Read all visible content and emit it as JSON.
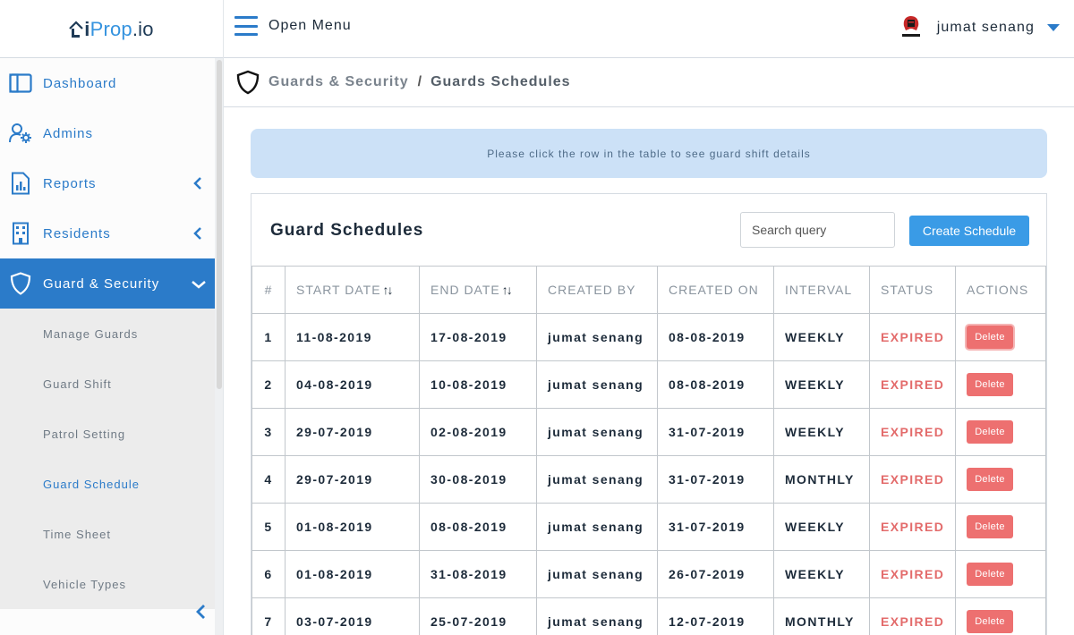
{
  "brand": {
    "part1": "i",
    "part2": "Prop",
    "part3": ".io"
  },
  "header": {
    "menu_label": "Open Menu",
    "user_name": "jumat senang"
  },
  "sidebar": {
    "items": [
      {
        "label": "Dashboard",
        "icon": "columns-icon"
      },
      {
        "label": "Admins",
        "icon": "user-gear-icon"
      },
      {
        "label": "Reports",
        "icon": "report-icon"
      },
      {
        "label": "Residents",
        "icon": "building-icon"
      },
      {
        "label": "Guard & Security",
        "icon": "shield-icon"
      }
    ],
    "sub_items": [
      "Manage Guards",
      "Guard Shift",
      "Patrol Setting",
      "Guard Schedule",
      "Time Sheet",
      "Vehicle Types"
    ]
  },
  "breadcrumb": {
    "parent": "Guards & Security",
    "separator": "/",
    "current": "Guards Schedules"
  },
  "info_text": "Please click the row in the table to see guard shift details",
  "card": {
    "title": "Guard Schedules",
    "search_placeholder": "Search query",
    "create_label": "Create Schedule"
  },
  "table": {
    "headers": [
      "#",
      "START DATE",
      "END DATE",
      "CREATED BY",
      "CREATED ON",
      "INTERVAL",
      "STATUS",
      "ACTIONS"
    ],
    "sort_glyph": "↑↓",
    "delete_label": "Delete",
    "rows": [
      [
        "1",
        "11-08-2019",
        "17-08-2019",
        "jumat senang",
        "08-08-2019",
        "WEEKLY",
        "EXPIRED"
      ],
      [
        "2",
        "04-08-2019",
        "10-08-2019",
        "jumat senang",
        "08-08-2019",
        "WEEKLY",
        "EXPIRED"
      ],
      [
        "3",
        "29-07-2019",
        "02-08-2019",
        "jumat senang",
        "31-07-2019",
        "WEEKLY",
        "EXPIRED"
      ],
      [
        "4",
        "29-07-2019",
        "30-08-2019",
        "jumat senang",
        "31-07-2019",
        "MONTHLY",
        "EXPIRED"
      ],
      [
        "5",
        "01-08-2019",
        "08-08-2019",
        "jumat senang",
        "31-07-2019",
        "WEEKLY",
        "EXPIRED"
      ],
      [
        "6",
        "01-08-2019",
        "31-08-2019",
        "jumat senang",
        "26-07-2019",
        "WEEKLY",
        "EXPIRED"
      ],
      [
        "7",
        "03-07-2019",
        "25-07-2019",
        "jumat senang",
        "12-07-2019",
        "MONTHLY",
        "EXPIRED"
      ]
    ]
  },
  "colors": {
    "accent": "#2b7bc9",
    "danger": "#ed7070",
    "info_bg": "#cce1f7"
  }
}
